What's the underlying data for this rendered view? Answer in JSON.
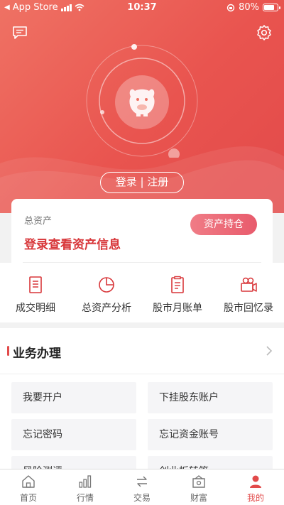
{
  "status_bar": {
    "carrier": "App Store",
    "time": "10:37",
    "battery": "80%",
    "battery_level": 0.8
  },
  "header": {
    "login_label": "登录 | 注册"
  },
  "asset_card": {
    "label": "总资产",
    "cta": "登录查看资产信息",
    "button": "资产持仓"
  },
  "shortcuts": [
    {
      "label": "成交明细",
      "icon": "document-icon"
    },
    {
      "label": "总资产分析",
      "icon": "pie-chart-icon"
    },
    {
      "label": "股市月账单",
      "icon": "bill-icon"
    },
    {
      "label": "股市回忆录",
      "icon": "video-camera-icon"
    }
  ],
  "business": {
    "title": "业务办理",
    "items": [
      "我要开户",
      "下挂股东账户",
      "忘记密码",
      "忘记资金账号",
      "风险测评",
      "创业板转签"
    ]
  },
  "tabbar": {
    "items": [
      {
        "label": "首页",
        "icon": "home-icon",
        "active": false
      },
      {
        "label": "行情",
        "icon": "bar-chart-icon",
        "active": false
      },
      {
        "label": "交易",
        "icon": "exchange-icon",
        "active": false
      },
      {
        "label": "财富",
        "icon": "wallet-icon",
        "active": false
      },
      {
        "label": "我的",
        "icon": "person-icon",
        "active": true
      }
    ]
  },
  "colors": {
    "accent": "#e24a4a",
    "hero": "#e9544f",
    "button_pink": "#e85b6c"
  }
}
